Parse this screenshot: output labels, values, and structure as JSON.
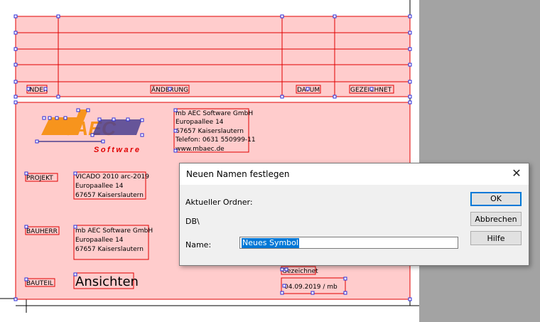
{
  "titleblock": {
    "headers": {
      "index": "INDEX",
      "aenderung": "ÄNDERUNG",
      "datum": "DATUM",
      "gezeichnet": "GEZEICHNET"
    },
    "logo": {
      "brand": "mbAEC",
      "tagline": "Software"
    },
    "company_address": {
      "line1": "mb AEC Software GmbH",
      "line2": "Europaallee 14",
      "line3": "67657 Kaiserslautern",
      "line4": "Telefon: 0631 550999-11",
      "line5": "www.mbaec.de"
    },
    "projekt": {
      "label": "PROJEKT",
      "line1": "VICADO 2010 arc-2019",
      "line2": "Europaallee 14",
      "line3": "67657 Kaiserslautern"
    },
    "bauherr": {
      "label": "BAUHERR",
      "line1": "mb AEC Software GmbH",
      "line2": "Europaallee 14",
      "line3": "67657 Kaiserslautern"
    },
    "bauteil": {
      "label": "BAUTEIL",
      "value": "Ansichten"
    },
    "gezeichnet_label": "Gezeichnet",
    "gezeichnet_value": "04.09.2019 / mb"
  },
  "dialog": {
    "title": "Neuen Namen festlegen",
    "close_icon": "close-icon",
    "folder_label": "Aktueller Ordner:",
    "folder_value": "DB\\",
    "name_label": "Name:",
    "name_value": "Neues Symbol",
    "ok_label": "OK",
    "cancel_label": "Abbrechen",
    "help_label": "Hilfe"
  },
  "colors": {
    "fill": "#ffcccc",
    "line": "#e00000",
    "handle": "#2a2ad8",
    "logo_orange": "#f7941d",
    "logo_purple": "#4b3f8f",
    "selection": "#0078d7"
  }
}
